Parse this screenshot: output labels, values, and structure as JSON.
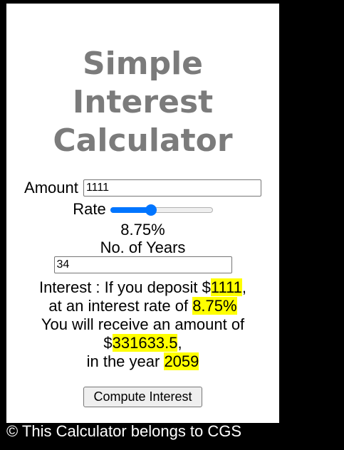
{
  "title": {
    "line1": "Simple",
    "line2": "Interest",
    "line3": "Calculator"
  },
  "form": {
    "amount_label": "Amount",
    "amount_value": "1111",
    "rate_label": "Rate",
    "rate_slider_fraction": 0.4,
    "rate_display": "8.75%",
    "years_label": "No. of Years",
    "years_value": "34"
  },
  "result": {
    "prefix": "Interest : If you deposit $",
    "deposit": "1111",
    "deposit_suffix": ",",
    "rate_prefix": "at an interest rate of ",
    "rate": "8.75%",
    "receive_text": "You will receive an amount of",
    "amount_prefix": "$",
    "amount": "331633.5",
    "amount_suffix": ",",
    "year_prefix": "in the year ",
    "year": "2059"
  },
  "actions": {
    "compute_label": "Compute Interest"
  },
  "footer": {
    "text": "© This Calculator belongs to CGS"
  },
  "colors": {
    "title": "#7b7b7b",
    "highlight": "#ffff00",
    "slider_accent": "#0075ff",
    "background": "#000000",
    "card": "#ffffff"
  }
}
